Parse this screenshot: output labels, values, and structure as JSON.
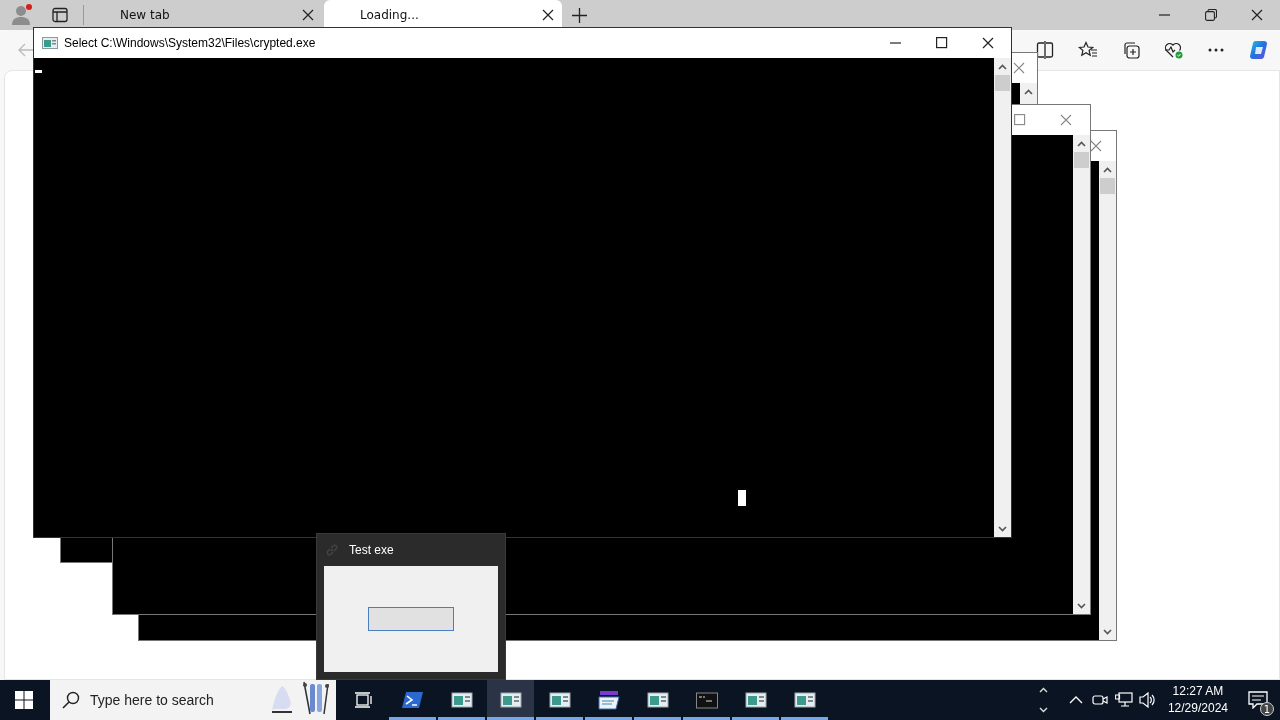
{
  "browser": {
    "tabs": [
      {
        "label": "New tab",
        "selected": false
      },
      {
        "label": "Loading...",
        "selected": true
      }
    ]
  },
  "console_window": {
    "title": "Select C:\\Windows\\System32\\Files\\crypted.exe"
  },
  "thumbnail": {
    "title": "Test exe"
  },
  "taskbar": {
    "search": {
      "placeholder": "Type here to search"
    },
    "apps": [
      {
        "kind": "powershell",
        "selected": false
      },
      {
        "kind": "console",
        "selected": false
      },
      {
        "kind": "console",
        "selected": true
      },
      {
        "kind": "console",
        "selected": false
      },
      {
        "kind": "explorer",
        "selected": false
      },
      {
        "kind": "console",
        "selected": false
      },
      {
        "kind": "cmd",
        "selected": false
      },
      {
        "kind": "console",
        "selected": false
      },
      {
        "kind": "console",
        "selected": false
      }
    ],
    "clock": {
      "time": "12:27 AM",
      "date": "12/29/2024"
    },
    "notifications": {
      "badge": "1"
    }
  }
}
